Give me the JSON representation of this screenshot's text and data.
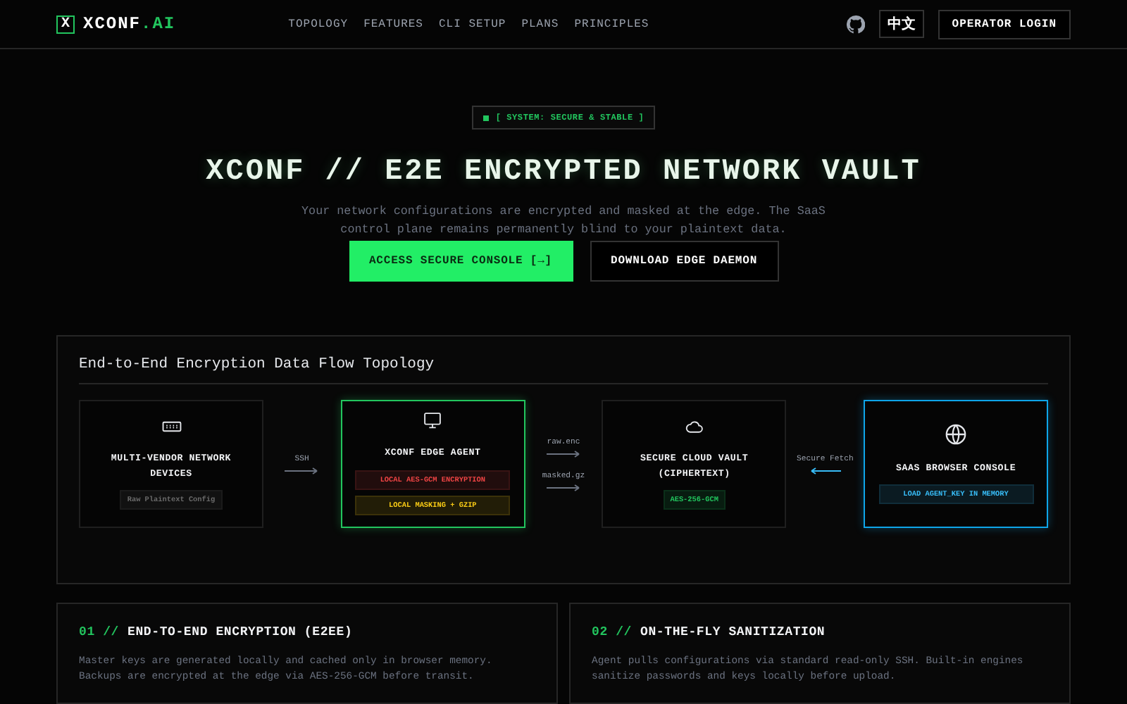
{
  "header": {
    "logo_mark": "X",
    "logo_name": "XCONF",
    "logo_suffix": ".AI",
    "nav": [
      "TOPOLOGY",
      "FEATURES",
      "CLI SETUP",
      "PLANS",
      "PRINCIPLES"
    ],
    "language": "中文",
    "login": "OPERATOR LOGIN"
  },
  "hero": {
    "status_badge": "[ SYSTEM: SECURE & STABLE ]",
    "title": "XCONF // E2E ENCRYPTED NETWORK VAULT",
    "description": "Your network configurations are encrypted and masked at the edge. The SaaS control plane remains permanently blind to your plaintext data.",
    "primary_button": "ACCESS SECURE CONSOLE [→]",
    "secondary_button": "DOWNLOAD EDGE DAEMON"
  },
  "topology": {
    "title": "End-to-End Encryption Data Flow Topology",
    "flow": [
      {
        "kind": "node",
        "title": "MULTI-VENDOR NETWORK DEVICES",
        "tags": [
          {
            "text": "Raw Plaintext Config",
            "color": "#6b6b6b"
          }
        ]
      },
      {
        "kind": "forward",
        "labels": [
          "SSH"
        ]
      },
      {
        "kind": "node",
        "title": "XCONF EDGE AGENT",
        "color": "#22c55e",
        "tags": [
          {
            "text": "LOCAL AES-GCM ENCRYPTION",
            "color": "#ef4444"
          },
          {
            "text": "LOCAL MASKING + GZIP",
            "color": "#facc15"
          }
        ]
      },
      {
        "kind": "forward",
        "labels": [
          "raw.enc",
          "masked.gz"
        ]
      },
      {
        "kind": "node",
        "title": "SECURE CLOUD VAULT (CIPHERTEXT)",
        "tags": [
          {
            "text": "AES-256-GCM",
            "color": "#22c55e"
          }
        ]
      },
      {
        "kind": "backward",
        "labels": [
          "Secure Fetch"
        ]
      },
      {
        "kind": "node",
        "title": "SAAS BROWSER CONSOLE",
        "color": "#0ea5e9",
        "tags": [
          {
            "text": "LOAD AGENT_KEY IN MEMORY",
            "color": "#38bdf8"
          }
        ]
      }
    ]
  },
  "features": [
    {
      "number": "01 //",
      "title": "END-TO-END ENCRYPTION (E2EE)",
      "text": "Master keys are generated locally and cached only in browser memory. Backups are encrypted at the edge via AES-256-GCM before transit."
    },
    {
      "number": "02 //",
      "title": "ON-THE-FLY SANITIZATION",
      "text": "Agent pulls configurations via standard read-only SSH. Built-in engines sanitize passwords and keys locally before upload."
    }
  ]
}
